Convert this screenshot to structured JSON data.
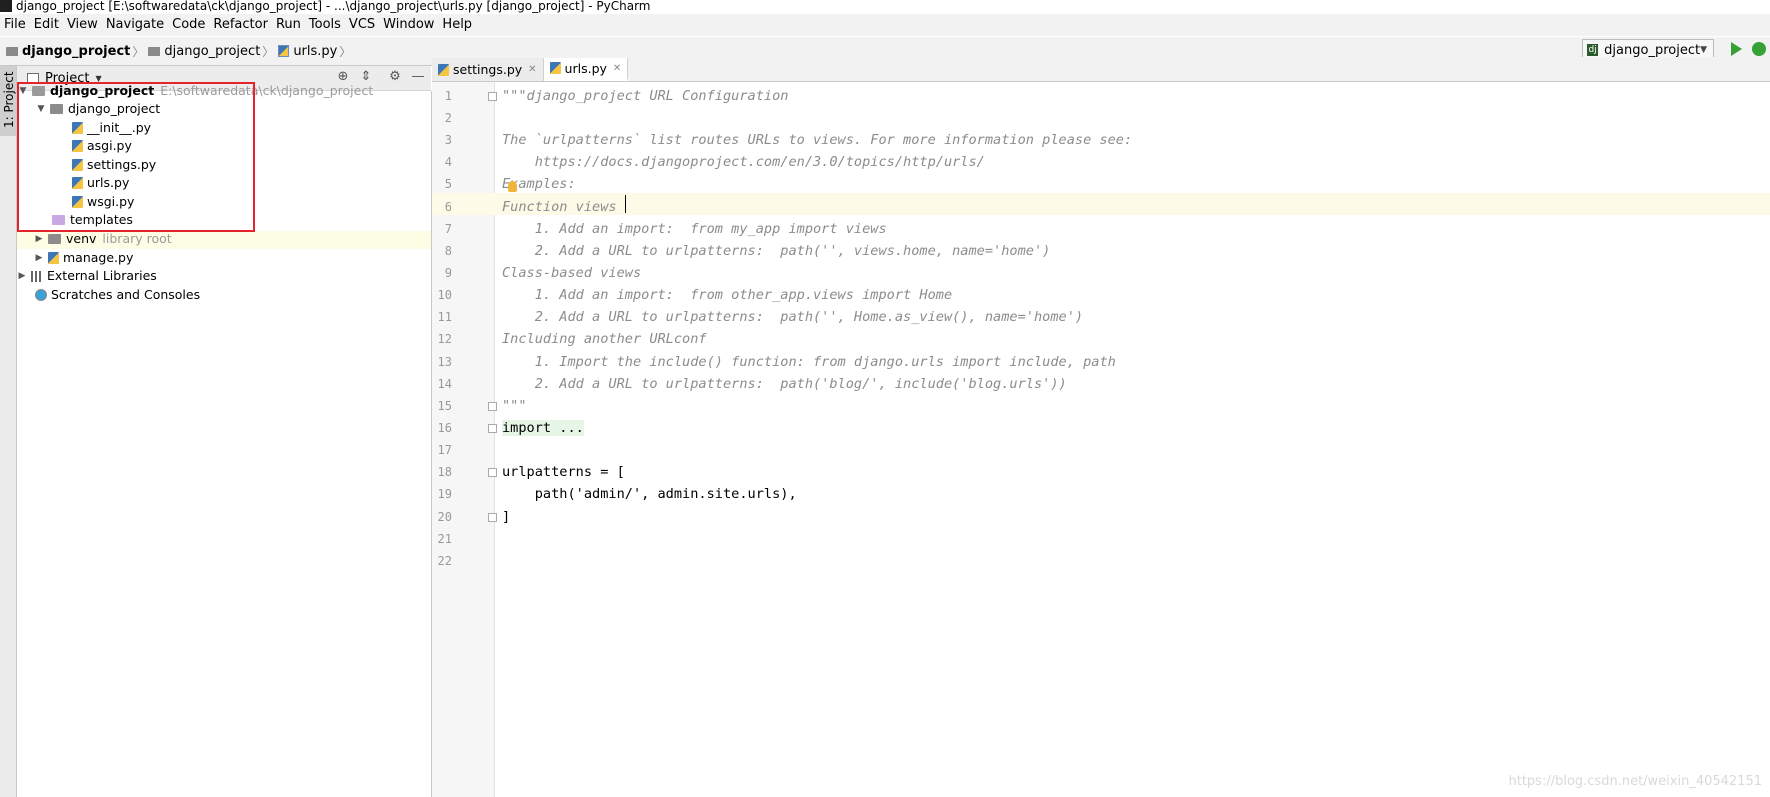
{
  "window": {
    "title": "django_project [E:\\softwaredata\\ck\\django_project] - ...\\django_project\\urls.py [django_project] - PyCharm"
  },
  "menu": [
    "File",
    "Edit",
    "View",
    "Navigate",
    "Code",
    "Refactor",
    "Run",
    "Tools",
    "VCS",
    "Window",
    "Help"
  ],
  "breadcrumb": [
    "django_project",
    "django_project",
    "urls.py"
  ],
  "run_config": {
    "label": "django_project"
  },
  "toolstrip": {
    "project_tab": "1: Project"
  },
  "project_panel": {
    "title": "Project",
    "tree": {
      "root": {
        "name": "django_project",
        "path": "E:\\softwaredata\\ck\\django_project"
      },
      "pkg": "django_project",
      "files": [
        "__init__.py",
        "asgi.py",
        "settings.py",
        "urls.py",
        "wsgi.py"
      ],
      "templates": "templates",
      "venv": {
        "name": "venv",
        "hint": "library root"
      },
      "manage": "manage.py",
      "external": "External Libraries",
      "scratches": "Scratches and Consoles"
    }
  },
  "editor": {
    "tabs": [
      {
        "label": "settings.py"
      },
      {
        "label": "urls.py"
      }
    ],
    "lines": [
      "\"\"\"django_project URL Configuration",
      "",
      "The `urlpatterns` list routes URLs to views. For more information please see:",
      "    https://docs.djangoproject.com/en/3.0/topics/http/urls/",
      "Examples:",
      "Function views",
      "    1. Add an import:  from my_app import views",
      "    2. Add a URL to urlpatterns:  path('', views.home, name='home')",
      "Class-based views",
      "    1. Add an import:  from other_app.views import Home",
      "    2. Add a URL to urlpatterns:  path('', Home.as_view(), name='home')",
      "Including another URLconf",
      "    1. Import the include() function: from django.urls import include, path",
      "    2. Add a URL to urlpatterns:  path('blog/', include('blog.urls'))",
      "\"\"\"",
      "import ...",
      "",
      "urlpatterns = [",
      "    path('admin/', admin.site.urls),",
      "]",
      ""
    ],
    "line_numbers": [
      "1",
      "2",
      "3",
      "4",
      "5",
      "6",
      "7",
      "8",
      "9",
      "10",
      "11",
      "12",
      "13",
      "14",
      "15",
      "16",
      "17",
      "18",
      "19",
      "20",
      "21",
      "22"
    ]
  },
  "watermark": "https://blog.csdn.net/weixin_40542151"
}
